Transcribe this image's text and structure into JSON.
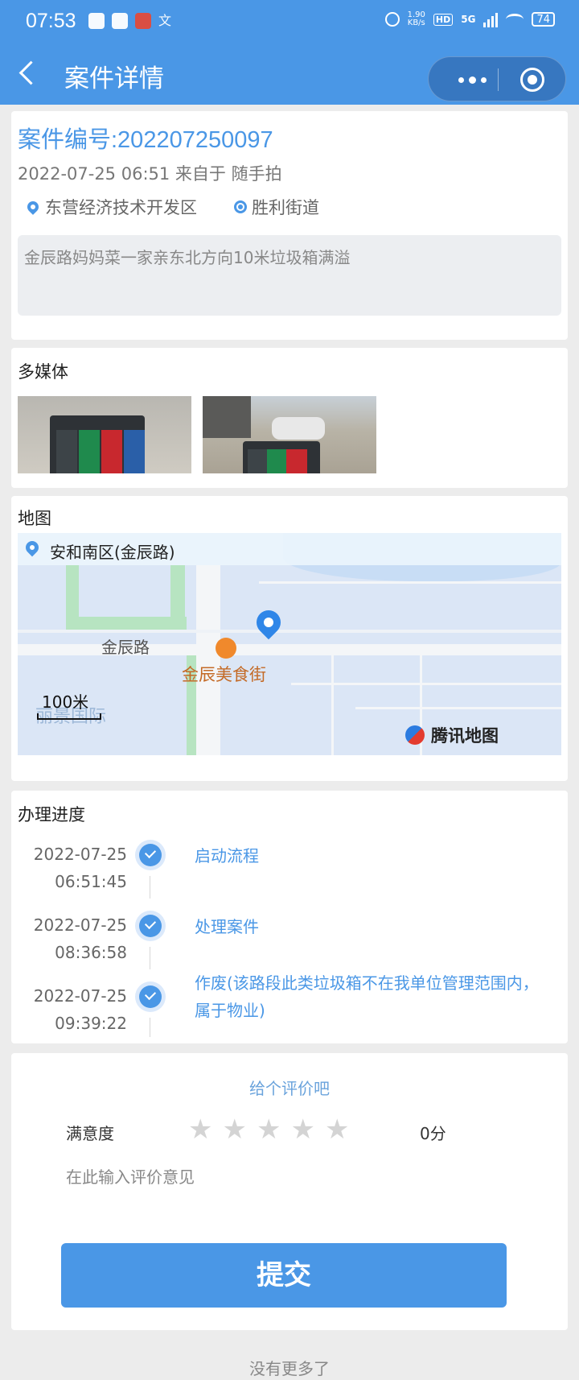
{
  "status_bar": {
    "time": "07:53",
    "net_speed": "1.90",
    "net_unit": "KB/s",
    "hd": "HD",
    "network": "5G",
    "battery": "74"
  },
  "nav": {
    "title": "案件详情"
  },
  "case": {
    "number_label": "案件编号:202207250097",
    "meta": "2022-07-25 06:51 来自于 随手拍",
    "district": "东营经济技术开发区",
    "street": "胜利街道",
    "description": "金辰路妈妈菜一家亲东北方向10米垃圾箱满溢"
  },
  "media": {
    "title": "多媒体"
  },
  "map": {
    "title": "地图",
    "location": "安和南区(金辰路)",
    "road_label": "金辰路",
    "poi_label": "金辰美食街",
    "scale": "100米",
    "watermark": "丽景国际",
    "provider": "腾讯地图"
  },
  "progress": {
    "title": "办理进度",
    "items": [
      {
        "date": "2022-07-25",
        "time": "06:51:45",
        "text": "启动流程"
      },
      {
        "date": "2022-07-25",
        "time": "08:36:58",
        "text": "处理案件"
      },
      {
        "date": "2022-07-25",
        "time": "09:39:22",
        "text": "作废(该路段此类垃圾箱不在我单位管理范围内，属于物业)"
      }
    ]
  },
  "rating": {
    "title": "给个评价吧",
    "label": "满意度",
    "stars_filled": 0,
    "stars_total": 5,
    "score": "0分",
    "comment_placeholder": "在此输入评价意见",
    "submit": "提交"
  },
  "footer": {
    "no_more": "没有更多了"
  },
  "colors": {
    "primary": "#4a97e6",
    "star_empty": "#d4d4d4"
  }
}
